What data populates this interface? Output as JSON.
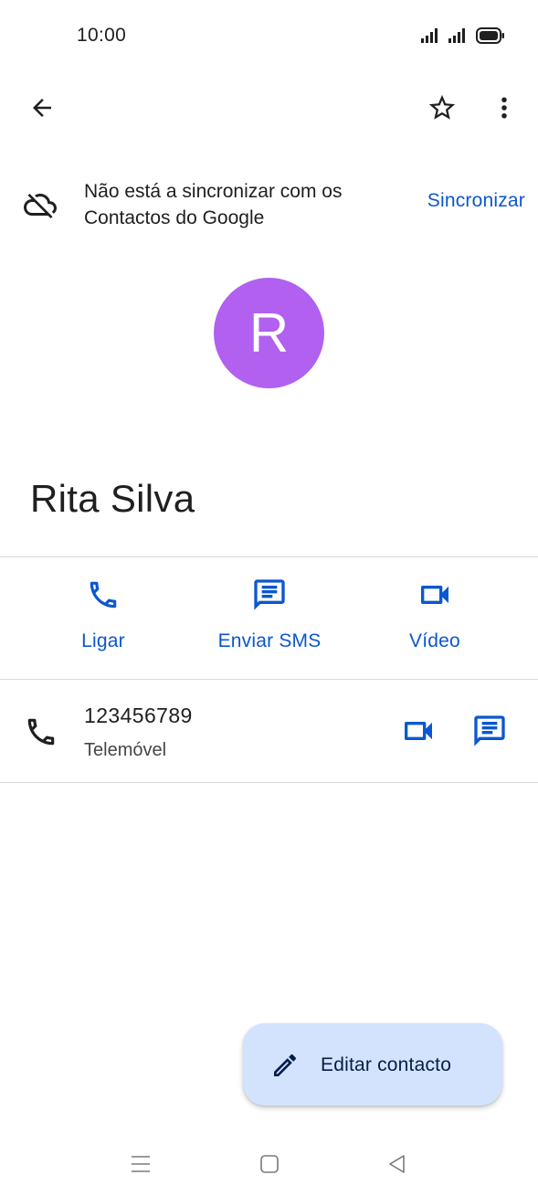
{
  "status_bar": {
    "time": "10:00"
  },
  "sync_banner": {
    "message": "Não está a sincronizar com os Contactos do Google",
    "action_label": "Sincronizar"
  },
  "contact": {
    "avatar_initial": "R",
    "avatar_color": "#b160ef",
    "name": "Rita Silva"
  },
  "actions": [
    {
      "label": "Ligar",
      "icon": "phone-icon"
    },
    {
      "label": "Enviar SMS",
      "icon": "message-icon"
    },
    {
      "label": "Vídeo",
      "icon": "video-icon"
    }
  ],
  "phone": {
    "number": "123456789",
    "type": "Telemóvel"
  },
  "fab": {
    "label": "Editar contacto",
    "icon": "pencil-icon",
    "color": "#d3e3fd"
  },
  "colors": {
    "accent": "#0b57d0",
    "text": "#1f1f1f"
  }
}
